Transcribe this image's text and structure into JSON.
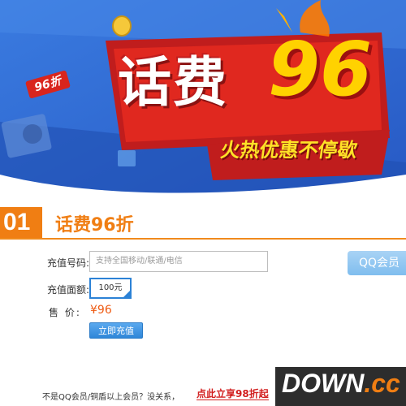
{
  "banner": {
    "title": "话费",
    "discount": "96",
    "subtitle": "火热优惠不停歇",
    "badge": "96折"
  },
  "section": {
    "number": "01",
    "title": "话费96折"
  },
  "form": {
    "phone_label": "充值号码:",
    "phone_placeholder": "支持全国移动/联通/电信",
    "amount_label": "充值面额:",
    "amount_value": "100元",
    "price_label": "售 价:",
    "price_value": "¥96",
    "submit_label": "立即充值"
  },
  "qq": {
    "label": "QQ会员"
  },
  "footer": {
    "note": "不是QQ会员/铜盾以上会员？没关系，",
    "link": "点此立享98折起"
  },
  "watermark": {
    "main": "DOWN",
    "suffix": ".cc"
  },
  "colors": {
    "accent_orange": "#f07e13",
    "banner_blue": "#2e6ad1",
    "button_blue": "#2f86d8",
    "price_red": "#ee5a12"
  }
}
